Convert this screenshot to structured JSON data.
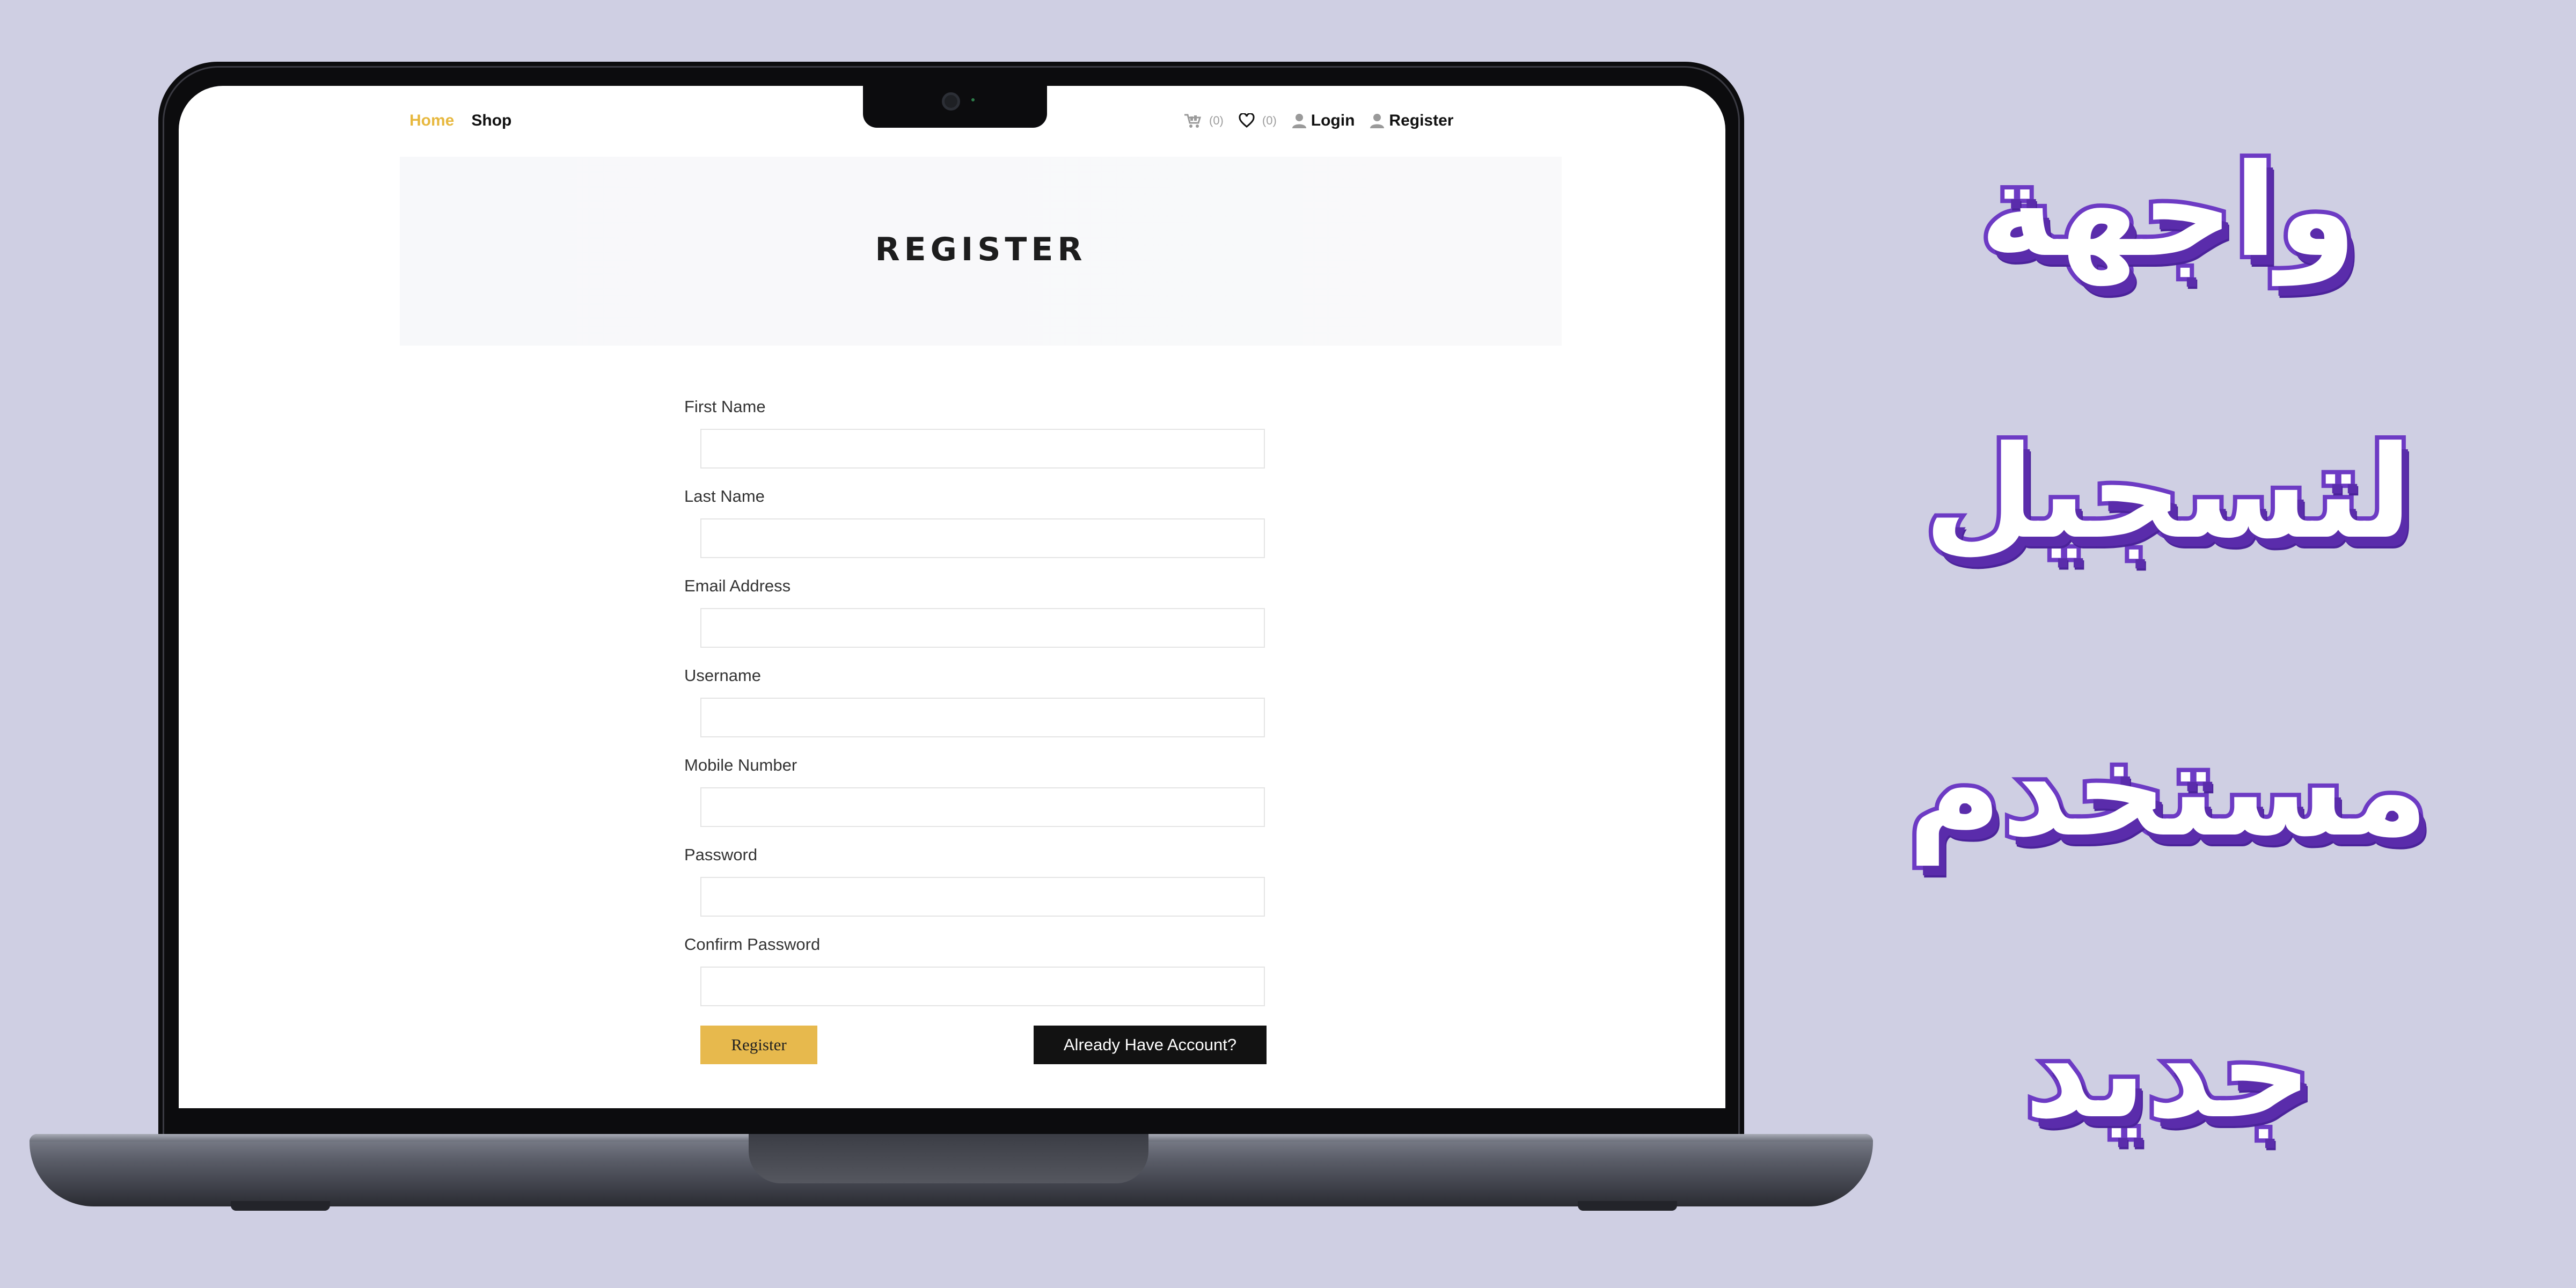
{
  "nav": {
    "home": "Home",
    "shop": "Shop",
    "cart_count": "(0)",
    "wishlist_count": "(0)",
    "login": "Login",
    "register": "Register"
  },
  "page": {
    "title": "REGISTER"
  },
  "form": {
    "fields": [
      {
        "label": "First Name",
        "value": ""
      },
      {
        "label": "Last Name",
        "value": ""
      },
      {
        "label": "Email Address",
        "value": ""
      },
      {
        "label": "Username",
        "value": ""
      },
      {
        "label": "Mobile Number",
        "value": ""
      },
      {
        "label": "Password",
        "value": ""
      },
      {
        "label": "Confirm Password",
        "value": ""
      }
    ],
    "register_button": "Register",
    "account_button": "Already Have Account?"
  },
  "headline": {
    "lines": [
      "واجهة",
      "لتسجيل",
      "مستخدم",
      "جديد"
    ]
  },
  "colors": {
    "background": "#cfcfe3",
    "accent": "#e7b83f",
    "headline_outline": "#6d3bc4",
    "dark_button": "#121212"
  }
}
